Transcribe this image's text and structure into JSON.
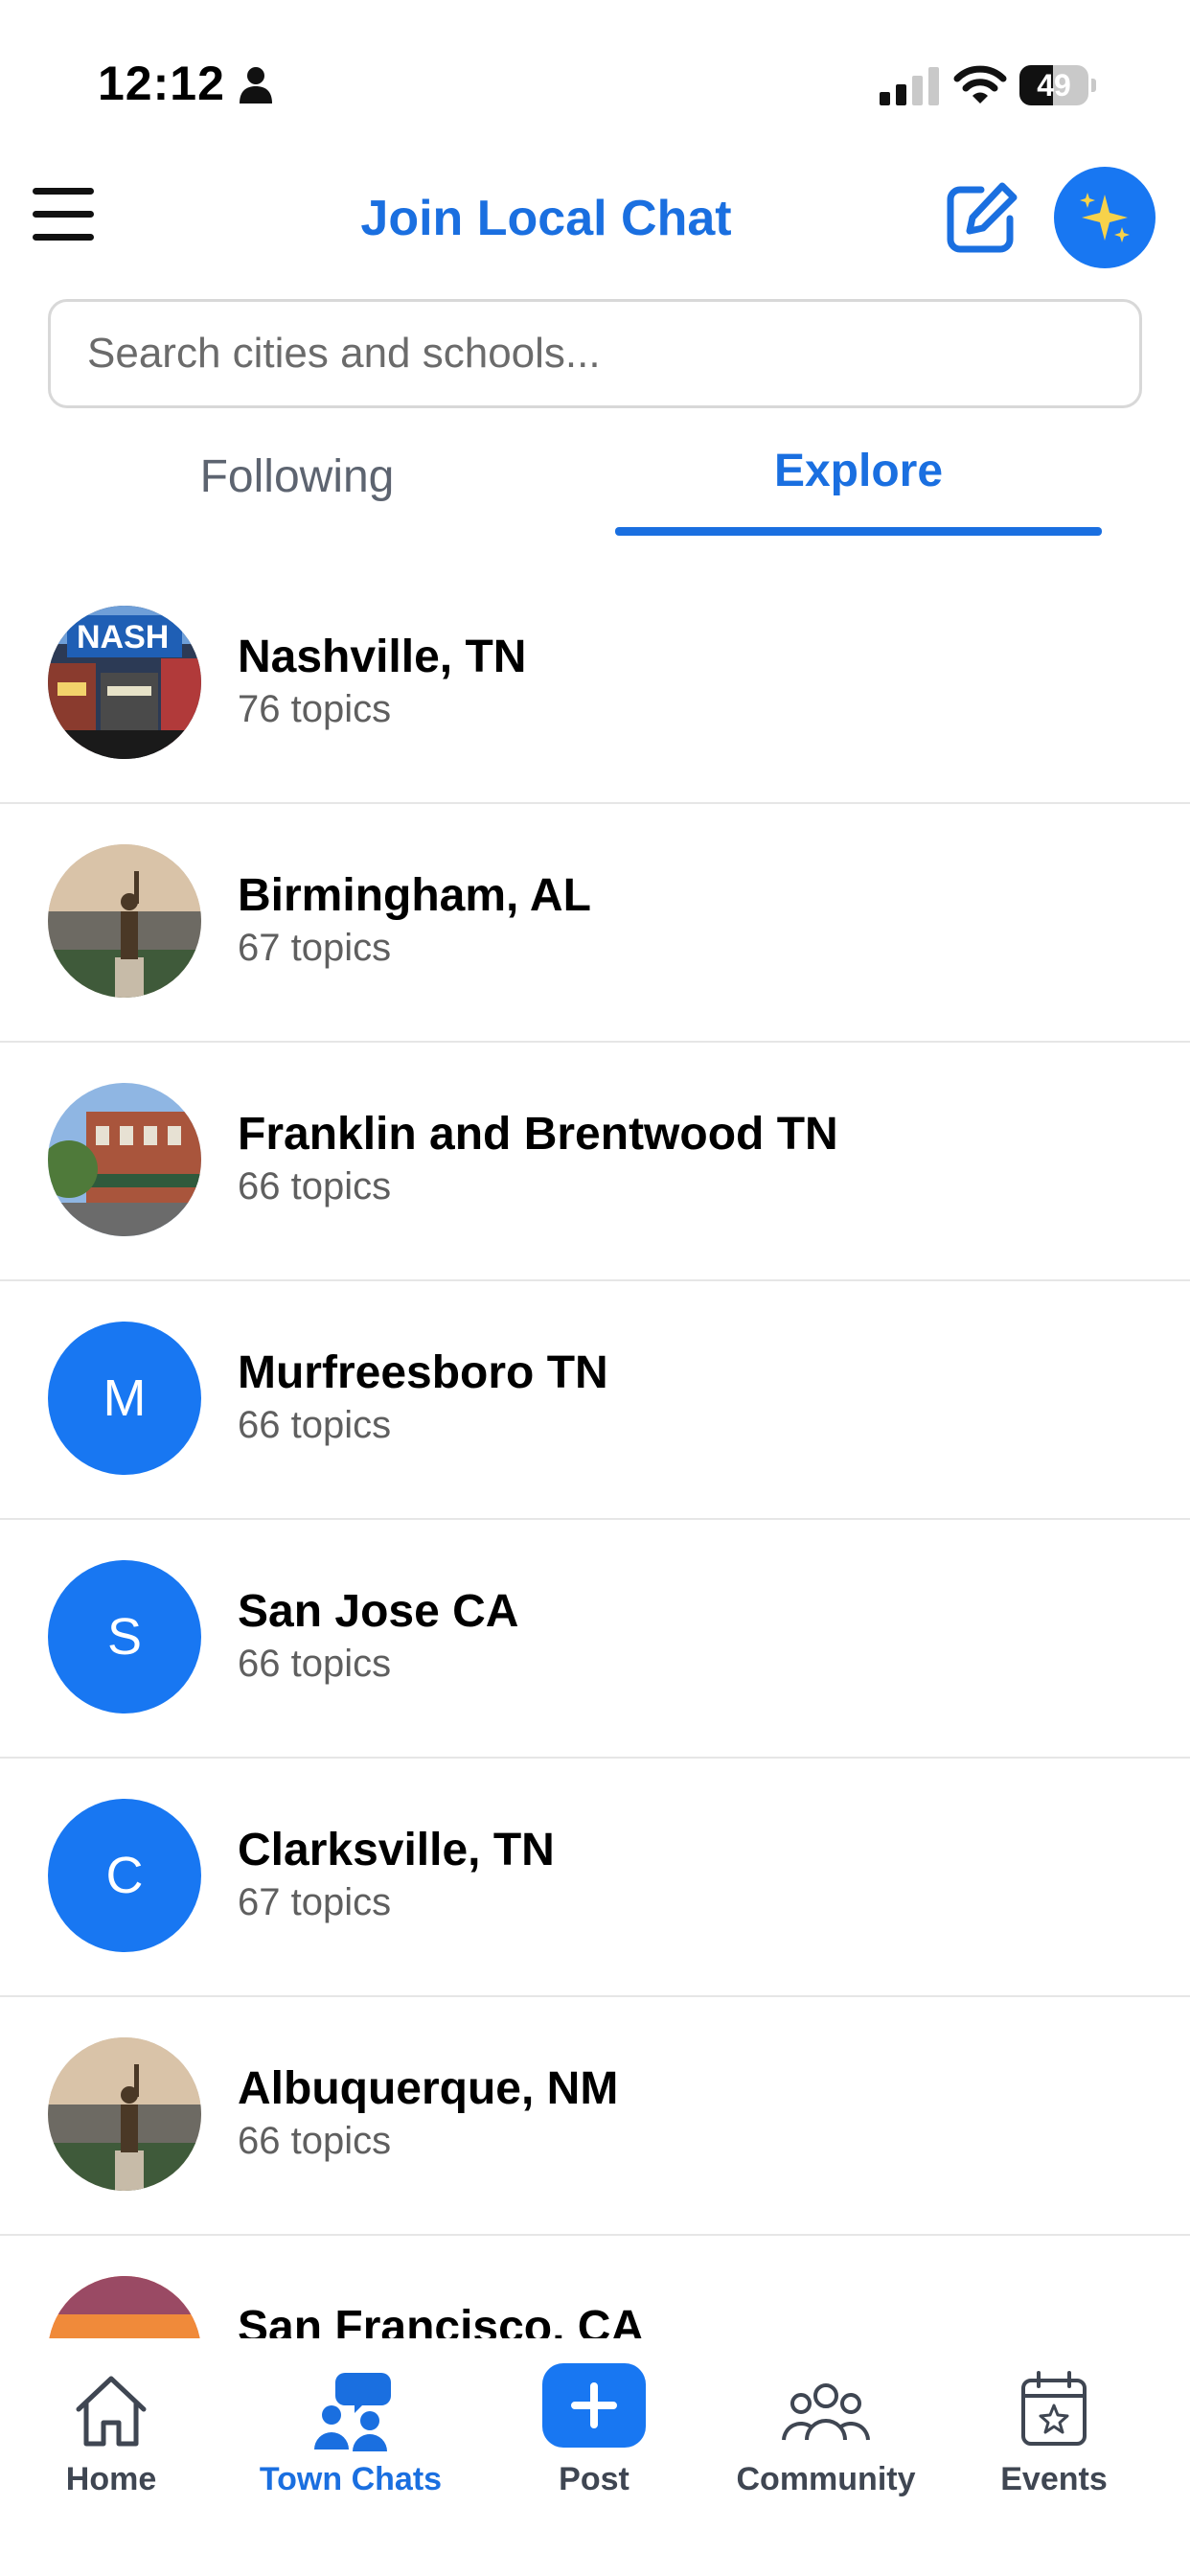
{
  "status_bar": {
    "time": "12:12",
    "battery_level": "49",
    "battery_fraction": 0.49
  },
  "header": {
    "title": "Join Local Chat",
    "menu_icon": "hamburger-menu-icon",
    "edit_icon": "edit-square-icon",
    "ai_icon": "sparkles-icon"
  },
  "search": {
    "placeholder": "Search cities and schools..."
  },
  "tabs": [
    {
      "label": "Following",
      "active": false
    },
    {
      "label": "Explore",
      "active": true
    }
  ],
  "towns": [
    {
      "name": "Nashville, TN",
      "topics": "76 topics",
      "avatar_type": "photo",
      "avatar_desc": "nashville-street-photo"
    },
    {
      "name": "Birmingham, AL",
      "topics": "67 topics",
      "avatar_type": "photo",
      "avatar_desc": "statue-city-photo"
    },
    {
      "name": "Franklin and Brentwood TN",
      "topics": "66 topics",
      "avatar_type": "photo",
      "avatar_desc": "downtown-street-photo"
    },
    {
      "name": "Murfreesboro TN",
      "topics": "66 topics",
      "avatar_type": "letter",
      "avatar_letter": "M"
    },
    {
      "name": "San Jose CA",
      "topics": "66 topics",
      "avatar_type": "letter",
      "avatar_letter": "S"
    },
    {
      "name": "Clarksville, TN",
      "topics": "67 topics",
      "avatar_type": "letter",
      "avatar_letter": "C"
    },
    {
      "name": "Albuquerque, NM",
      "topics": "66 topics",
      "avatar_type": "photo",
      "avatar_desc": "statue-city-photo"
    },
    {
      "name": "San Francisco, CA",
      "topics": "",
      "avatar_type": "photo",
      "avatar_desc": "sunset-photo"
    }
  ],
  "bottom_nav": [
    {
      "label": "Home",
      "icon": "home-icon",
      "active": false
    },
    {
      "label": "Town Chats",
      "icon": "town-chats-icon",
      "active": true
    },
    {
      "label": "Post",
      "icon": "plus-icon",
      "active": false
    },
    {
      "label": "Community",
      "icon": "community-icon",
      "active": false
    },
    {
      "label": "Events",
      "icon": "calendar-star-icon",
      "active": false
    }
  ],
  "colors": {
    "accent": "#1a6fe0",
    "avatar_blue": "#1877f2",
    "divider": "#e6e6e6",
    "muted_text": "#5f5f5f"
  }
}
